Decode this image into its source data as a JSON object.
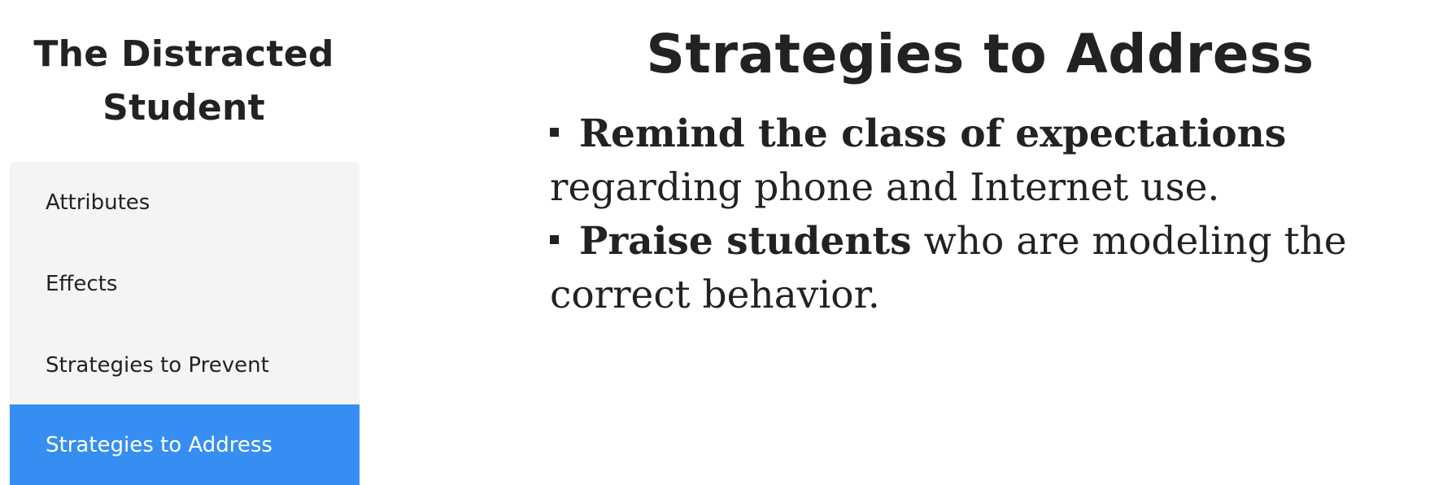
{
  "sidebar": {
    "title_line1": "The Distracted",
    "title_line2": "Student",
    "items": [
      {
        "label": "Attributes",
        "active": false
      },
      {
        "label": "Effects",
        "active": false
      },
      {
        "label": "Strategies to Prevent",
        "active": false
      },
      {
        "label": "Strategies to Address",
        "active": true
      }
    ]
  },
  "main": {
    "title": "Strategies to Address",
    "bullets": [
      {
        "bold": "Remind the class of expectations",
        "rest": " regarding phone and Internet use."
      },
      {
        "bold": "Praise students",
        "rest": " who are modeling the correct behavior."
      }
    ]
  },
  "colors": {
    "text": "#222222",
    "nav_background": "#f4f4f4",
    "active_item": "#368ef2",
    "active_text": "#ffffff"
  }
}
